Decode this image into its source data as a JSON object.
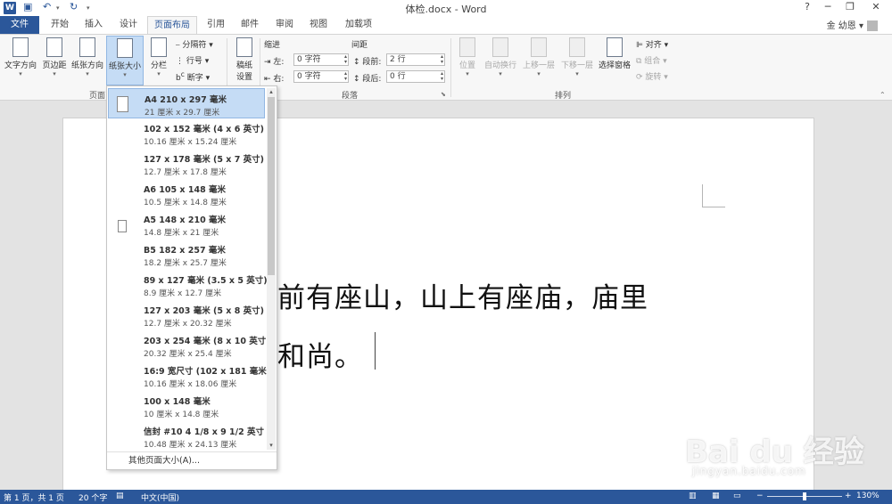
{
  "titlebar": {
    "logo": "W",
    "title": "体检.docx - Word",
    "help": "?",
    "minimize": "─",
    "restore": "❐",
    "close": "✕"
  },
  "tabs": {
    "file": "文件",
    "items": [
      "开始",
      "插入",
      "设计",
      "页面布局",
      "引用",
      "邮件",
      "审阅",
      "视图",
      "加载项"
    ],
    "active": "页面布局",
    "user": "金 幼恩"
  },
  "ribbon": {
    "text_direction": "文字方向",
    "margins": "页边距",
    "orientation": "纸张方向",
    "size": "纸张大小",
    "columns": "分栏",
    "breaks": "分隔符",
    "line_numbers": "行号",
    "hyphenation": "断字",
    "page_setup_group": "页面",
    "draft_paper_line1": "稿纸",
    "draft_paper_line2": "设置",
    "indent_label": "缩进",
    "indent_left_label": "左:",
    "indent_left_value": "0 字符",
    "indent_right_label": "右:",
    "indent_right_value": "0 字符",
    "spacing_label": "间距",
    "spacing_before_label": "段前:",
    "spacing_before_value": "2 行",
    "spacing_after_label": "段后:",
    "spacing_after_value": "0 行",
    "paragraph_group": "段落",
    "position": "位置",
    "wrap_text": "自动换行",
    "bring_forward": "上移一层",
    "send_backward": "下移一层",
    "selection_pane": "选择窗格",
    "align": "对齐",
    "group": "组合",
    "rotate": "旋转",
    "arrange_group": "排列"
  },
  "paper_sizes": [
    {
      "name": "A4 210 x 297 毫米",
      "dim": "21 厘米 x 29.7 厘米"
    },
    {
      "name": "102 x 152 毫米 (4 x 6 英寸)",
      "dim": "10.16 厘米 x 15.24 厘米"
    },
    {
      "name": "127 x 178 毫米 (5 x 7 英寸)",
      "dim": "12.7 厘米 x 17.8 厘米"
    },
    {
      "name": "A6 105 x 148 毫米",
      "dim": "10.5 厘米 x 14.8 厘米"
    },
    {
      "name": "A5 148 x 210 毫米",
      "dim": "14.8 厘米 x 21 厘米"
    },
    {
      "name": "B5 182 x 257 毫米",
      "dim": "18.2 厘米 x 25.7 厘米"
    },
    {
      "name": "89 x 127 毫米 (3.5 x 5 英寸)",
      "dim": "8.9 厘米 x 12.7 厘米"
    },
    {
      "name": "127 x 203 毫米 (5 x 8 英寸)",
      "dim": "12.7 厘米 x 20.32 厘米"
    },
    {
      "name": "203 x 254 毫米 (8 x 10 英寸)",
      "dim": "20.32 厘米 x 25.4 厘米"
    },
    {
      "name": "16:9 宽尺寸 (102 x 181 毫米)",
      "dim": "10.16 厘米 x 18.06 厘米"
    },
    {
      "name": "100 x 148 毫米",
      "dim": "10 厘米 x 14.8 厘米"
    },
    {
      "name": "信封 #10 4 1/8 x 9 1/2 英寸",
      "dim": "10.48 厘米 x 24.13 厘米"
    }
  ],
  "more_sizes": "其他页面大小(A)...",
  "document": {
    "line1": "前有座山，山上有座庙，庙里",
    "line2": "和尚。"
  },
  "status": {
    "page": "第 1 页，共 1 页",
    "words": "20 个字",
    "language": "中文(中国)",
    "zoom_out": "−",
    "zoom_in": "+",
    "zoom": "130%",
    "zoom_fraction": 0.5
  },
  "watermark": {
    "brand": "Bai du 经验",
    "url": "jingyan.baidu.com"
  }
}
